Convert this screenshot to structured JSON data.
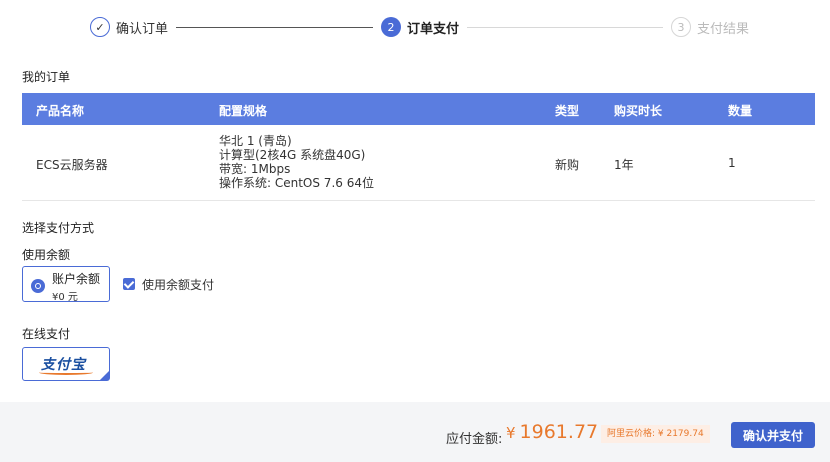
{
  "steps": [
    {
      "label": "确认订单",
      "marker": "✓",
      "state": "done"
    },
    {
      "label": "订单支付",
      "marker": "2",
      "state": "active"
    },
    {
      "label": "支付结果",
      "marker": "3",
      "state": "pending"
    }
  ],
  "order": {
    "title": "我的订单",
    "columns": [
      "产品名称",
      "配置规格",
      "类型",
      "购买时长",
      "数量"
    ],
    "row": {
      "name": "ECS云服务器",
      "spec": [
        "华北 1 (青岛)",
        "计算型(2核4G 系统盘40G)",
        "带宽: 1Mbps",
        "操作系统: CentOS 7.6 64位"
      ],
      "type": "新购",
      "duration": "1年",
      "quantity": "1"
    }
  },
  "payment": {
    "title": "选择支付方式",
    "balance_section": "使用余额",
    "balance_label": "账户余额",
    "balance_value": "¥0 元",
    "use_balance_label": "使用余额支付",
    "use_balance_checked": true,
    "online_section": "在线支付",
    "alipay_text": "支付宝"
  },
  "footer": {
    "amount_label": "应付金额:",
    "currency": "¥",
    "amount": "1961.77",
    "aliyun_price": "阿里云价格: ¥ 2179.74",
    "confirm_label": "确认并支付"
  },
  "colors": {
    "accent": "#4a6bd6",
    "table_header": "#5b7de0",
    "price": "#e8792d",
    "footer_bg": "#f4f5f7"
  }
}
